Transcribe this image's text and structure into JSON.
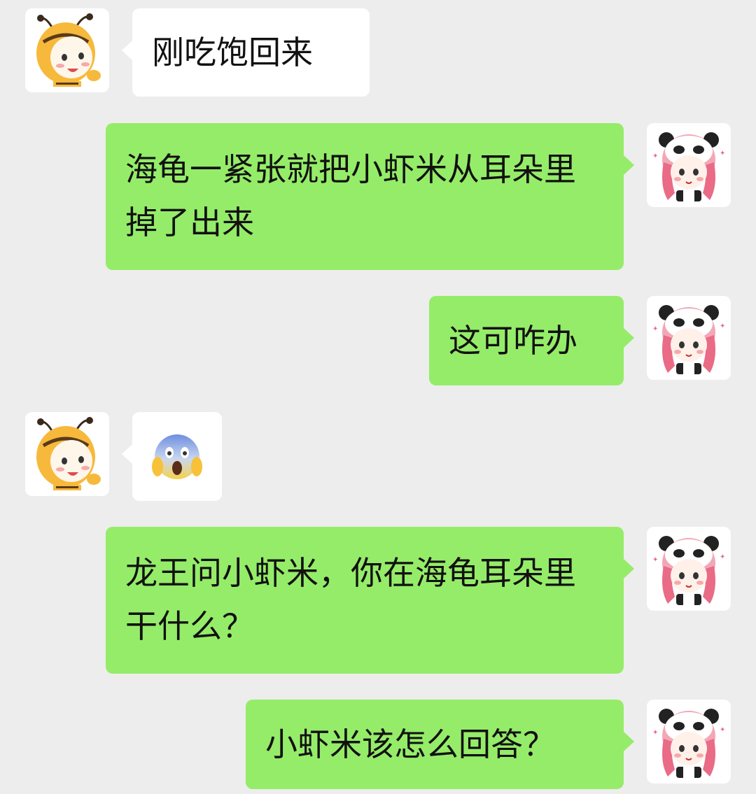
{
  "chat": {
    "messages": [
      {
        "sender": "friend",
        "text": "刚吃饱回来"
      },
      {
        "sender": "me",
        "text": "海龟一紧张就把小虾米从耳朵里掉了出来"
      },
      {
        "sender": "me",
        "text": "这可咋办"
      },
      {
        "sender": "friend",
        "emoji": "face-screaming-in-fear"
      },
      {
        "sender": "me",
        "text": "龙王问小虾米，你在海龟耳朵里干什么？"
      },
      {
        "sender": "me",
        "text": "小虾米该怎么回答？"
      }
    ]
  },
  "colors": {
    "background": "#ededed",
    "incoming_bubble": "#ffffff",
    "outgoing_bubble": "#95ec69"
  },
  "icons": {
    "friend_avatar": "bee-costume-cartoon-avatar-icon",
    "my_avatar": "panda-hood-girl-cartoon-avatar-icon"
  }
}
